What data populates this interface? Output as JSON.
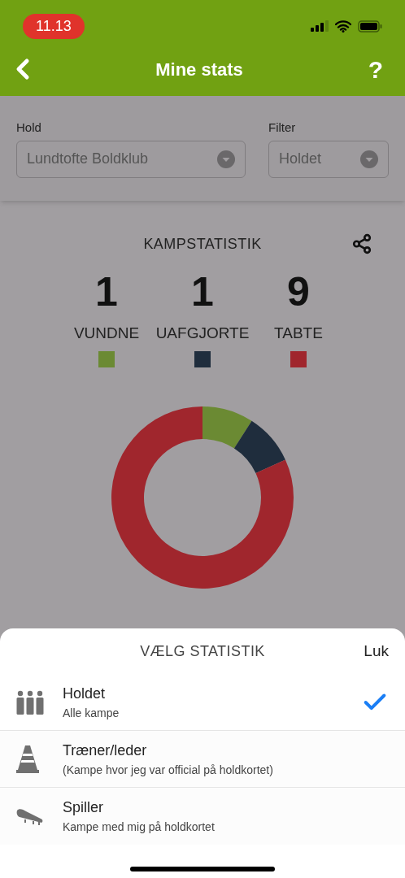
{
  "status_bar": {
    "time": "11.13"
  },
  "header": {
    "title": "Mine stats",
    "help": "?"
  },
  "filters": [
    {
      "label": "Hold",
      "value": "Lundtofte Boldklub"
    },
    {
      "label": "Filter",
      "value": "Holdet"
    }
  ],
  "stats": {
    "title": "KAMPSTATISTIK",
    "items": [
      {
        "count": "1",
        "label": "VUNDNE",
        "color": "#6b8a33"
      },
      {
        "count": "1",
        "label": "UAFGJORTE",
        "color": "#1f2d3d"
      },
      {
        "count": "9",
        "label": "TABTE",
        "color": "#a0262d"
      }
    ]
  },
  "sheet": {
    "title": "VÆLG STATISTIK",
    "close": "Luk",
    "options": [
      {
        "kind": "team",
        "title": "Holdet",
        "subtitle": "Alle kampe",
        "selected": true
      },
      {
        "kind": "coach",
        "title": "Træner/leder",
        "subtitle": "(Kampe hvor jeg var official på holdkortet)",
        "selected": false
      },
      {
        "kind": "player",
        "title": "Spiller",
        "subtitle": "Kampe med mig på holdkortet",
        "selected": false
      }
    ]
  }
}
